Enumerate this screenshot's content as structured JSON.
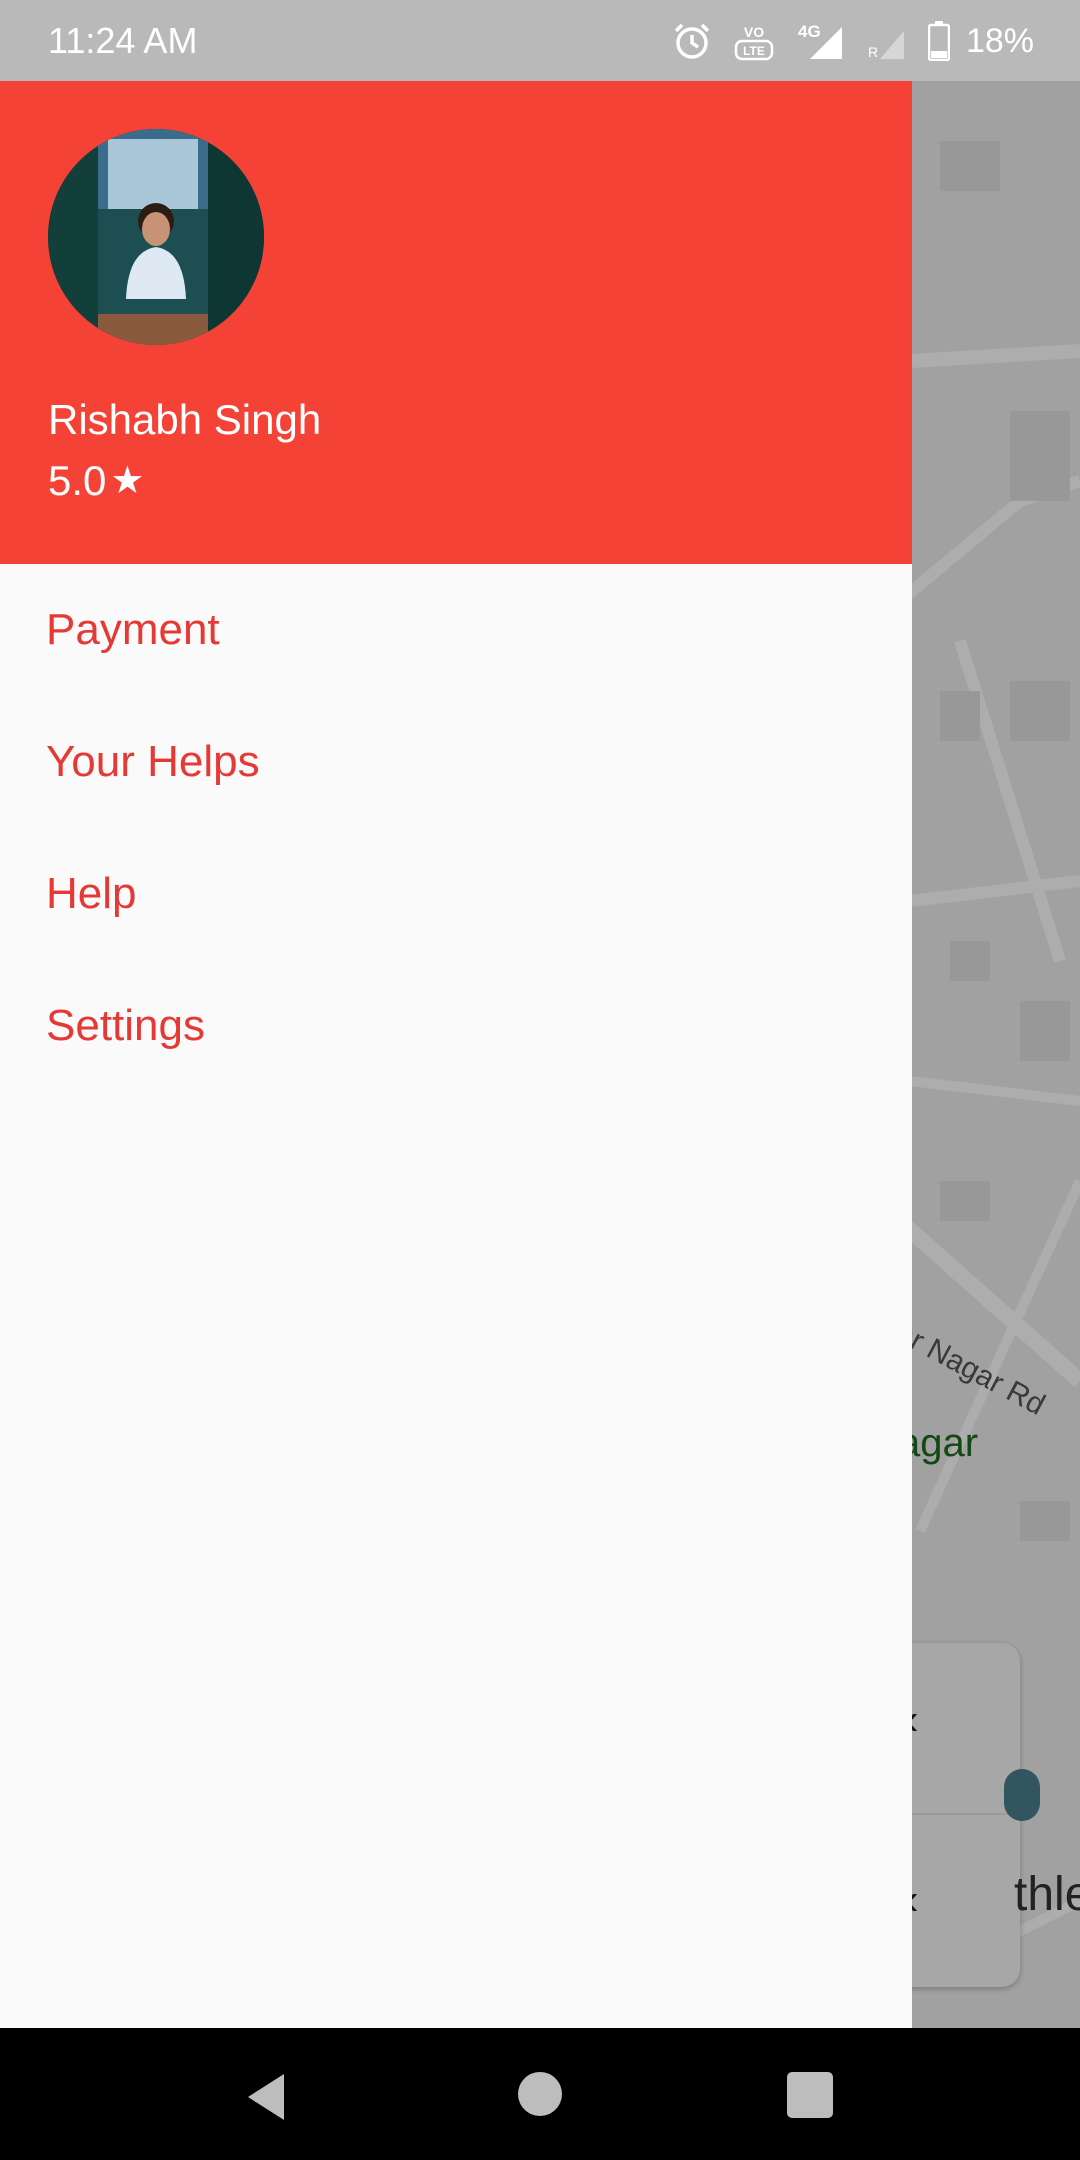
{
  "status_bar": {
    "time": "11:24 AM",
    "icons": [
      "alarm-icon",
      "volte-icon",
      "signal-4g-icon",
      "signal-roaming-icon",
      "battery-icon"
    ],
    "volte_label": "VO LTE",
    "network_label": "4G",
    "battery_percent": "18%"
  },
  "drawer": {
    "header_color": "#f44336",
    "user": {
      "name": "Rishabh Singh",
      "rating": "5.0",
      "rating_icon": "star-icon"
    },
    "menu": [
      {
        "label": "Payment"
      },
      {
        "label": "Your Helps"
      },
      {
        "label": "Help"
      },
      {
        "label": "Settings"
      }
    ]
  },
  "map": {
    "road_label": "ar Nagar Rd",
    "area_label": "agar",
    "partial_text": "thle"
  },
  "nav_bar": {
    "buttons": [
      "back-icon",
      "home-icon",
      "recents-icon"
    ]
  }
}
